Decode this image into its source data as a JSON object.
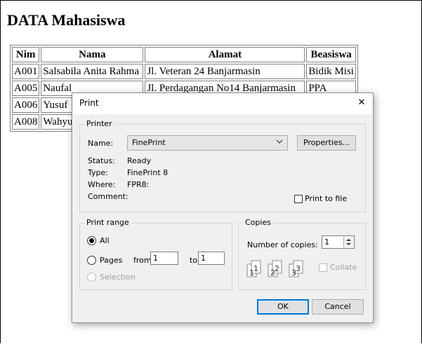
{
  "page": {
    "title": "DATA Mahasiswa",
    "table": {
      "headers": [
        "Nim",
        "Nama",
        "Alamat",
        "Beasiswa"
      ],
      "rows": [
        [
          "A001",
          "Salsabila Anita Rahma",
          "Jl. Veteran 24 Banjarmasin",
          "Bidik Misi"
        ],
        [
          "A005",
          "Naufal",
          "Jl. Perdagangan No14 Banjarmasin",
          "PPA"
        ],
        [
          "A006",
          "Yusuf",
          "",
          ""
        ],
        [
          "A008",
          "Wahyu",
          "",
          ""
        ]
      ]
    }
  },
  "dialog": {
    "title": "Print",
    "close_glyph": "✕",
    "printer": {
      "legend": "Printer",
      "name_label": "Name:",
      "name_value": "FinePrint",
      "properties_label": "Properties...",
      "status_label": "Status:",
      "status_value": "Ready",
      "type_label": "Type:",
      "type_value": "FinePrint 8",
      "where_label": "Where:",
      "where_value": "FPR8:",
      "comment_label": "Comment:",
      "print_to_file_label": "Print to file"
    },
    "range": {
      "legend": "Print range",
      "all_label": "All",
      "pages_label": "Pages",
      "from_label": "from:",
      "from_value": "1",
      "to_label": "to:",
      "to_value": "1",
      "selection_label": "Selection"
    },
    "copies": {
      "legend": "Copies",
      "number_label": "Number of copies:",
      "number_value": "1",
      "collate_label": "Collate"
    },
    "ok_label": "OK",
    "cancel_label": "Cancel"
  },
  "colors": {
    "accent": "#0078d7",
    "dialog_body": "#f0f0f0",
    "disabled_text": "#a0a0a0"
  }
}
